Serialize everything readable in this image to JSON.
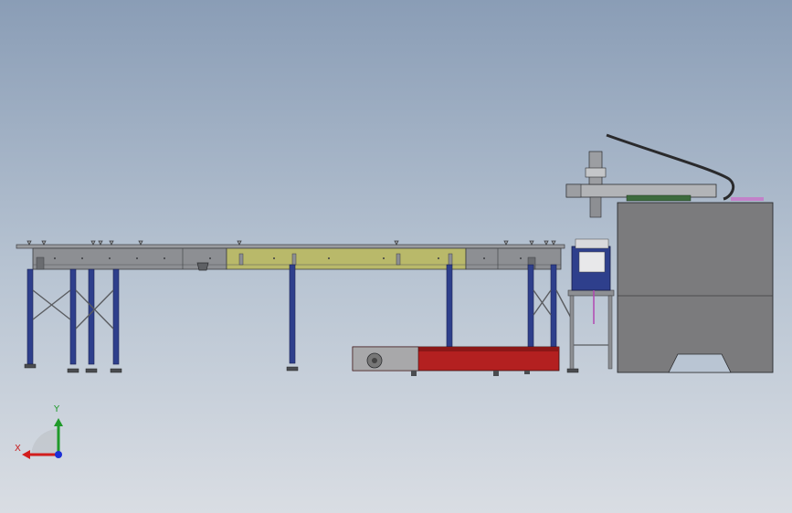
{
  "triad": {
    "x_label": "X",
    "y_label": "Y"
  },
  "colors": {
    "background_top": "#8a9db6",
    "background_bottom": "#d9dde3",
    "frame_steel": "#8d8f93",
    "frame_edge": "#3c3e42",
    "leg_blue": "#2e3f8c",
    "belt_yellow": "#b9b96a",
    "base_red": "#b32020",
    "machine_grey": "#7b7b7d",
    "axis_x": "#d21d1d",
    "axis_y": "#1f9a2a",
    "axis_z": "#1c2fd6"
  }
}
